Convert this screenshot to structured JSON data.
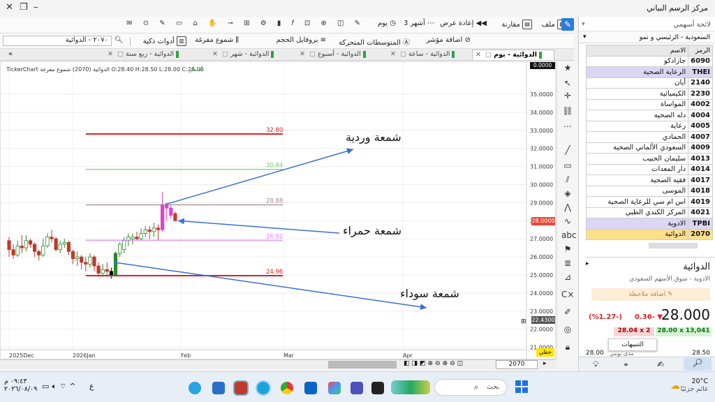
{
  "window": {
    "title": "مركز الرسم البياني"
  },
  "toolbar1": {
    "items": [
      "ملف",
      "مقارنة",
      "إعادة عرض",
      "3 أشهر",
      "يوم"
    ]
  },
  "toolbar2": {
    "items": [
      "أدوات ذكية",
      "شموع مفرغة",
      "بروفايل الحجم",
      "المتوسطات المتحركة",
      "اضافة مؤشر"
    ],
    "symbol_field": "٢٠٧٠ - الدوائية"
  },
  "tabs": [
    "الدوائية - يوم",
    "الدوائية - ساعة",
    "الدوائية - أسبوع",
    "الدوائية - شهر",
    "الدوائية - ربع سنة"
  ],
  "chart": {
    "header": "TickerChart  الدوائية (2070)  شموع مفرغة  O:28.40  H:28.50  L:28.00  C:28.00",
    "small_label": "أسعار",
    "y_ticks": [
      "35.0000",
      "34.0000",
      "33.0000",
      "32.0000",
      "31.0000",
      "30.0000",
      "29.0000",
      "28.0000",
      "27.0000",
      "26.0000",
      "25.0000",
      "24.0000",
      "23.0000",
      "22.0000",
      "21.0000"
    ],
    "x_ticks": [
      "2025Dec",
      "2026Jan",
      "Feb",
      "Mar",
      "Apr"
    ],
    "price_badge": "28.0000",
    "price_badge2": "22.4300",
    "top_badge": "0.0000",
    "bottom_label": "خطي",
    "symbol_code": "2070",
    "levels": [
      {
        "label": "32.80",
        "color": "#d22"
      },
      {
        "label": "30.84",
        "color": "#7c7"
      },
      {
        "label": "28.88",
        "color": "#a88"
      },
      {
        "label": "26.92",
        "color": "#d8f"
      },
      {
        "label": "24.96",
        "color": "#d22"
      }
    ],
    "annotations": [
      "شمعة وردية",
      "شمعة حمراء",
      "شمعة سوداء"
    ]
  },
  "panel": {
    "title": "لائحة أسهمي",
    "market": "السعودية - الرئيسي و نمو",
    "columns": [
      "الرمز",
      "الاسم"
    ],
    "rows": [
      {
        "sym": "6090",
        "name": "جازادكو",
        "type": "row"
      },
      {
        "sym": "THEI",
        "name": "الرعاية الصحية",
        "type": "sec"
      },
      {
        "sym": "2140",
        "name": "أيان",
        "type": "row"
      },
      {
        "sym": "2230",
        "name": "الكيميائية",
        "type": "row"
      },
      {
        "sym": "4002",
        "name": "المواساة",
        "type": "row"
      },
      {
        "sym": "4004",
        "name": "دله الصحية",
        "type": "row"
      },
      {
        "sym": "4005",
        "name": "رعاية",
        "type": "row"
      },
      {
        "sym": "4007",
        "name": "الحمادي",
        "type": "row"
      },
      {
        "sym": "4009",
        "name": "السعودي الألماني الصحية",
        "type": "row"
      },
      {
        "sym": "4013",
        "name": "سليمان الحبيب",
        "type": "row"
      },
      {
        "sym": "4014",
        "name": "دار المعدات",
        "type": "row"
      },
      {
        "sym": "4017",
        "name": "فقيه الصحية",
        "type": "row"
      },
      {
        "sym": "4018",
        "name": "الموسى",
        "type": "row"
      },
      {
        "sym": "4019",
        "name": "اس ام سي للرعاية الصحية",
        "type": "row"
      },
      {
        "sym": "4021",
        "name": "المركز الكندي الطبي",
        "type": "row"
      },
      {
        "sym": "TPBI",
        "name": "الادوية",
        "type": "sec"
      },
      {
        "sym": "2070",
        "name": "الدوائية",
        "type": "sel"
      }
    ],
    "info": {
      "name": "الدوائية",
      "sub": "الادوية - سوق الأسهم السعودي",
      "note_btn": "اضافة ملاحظة",
      "price": "28.000",
      "change": "0.36-",
      "pct": "(%1.27-)",
      "bid": "28.04 x 2",
      "ask": "28.00 x 13,041",
      "alerts": "التنبيهات",
      "low": "28.00",
      "high": "28.50",
      "range_label": "مدى يومي"
    }
  },
  "taskbar": {
    "weather_temp": "20°C",
    "weather_desc": "غائم جزئيًا",
    "search": "بحث",
    "time": "٠٩:٤٣ م",
    "date": "٢٠٢٦/٠٨/٠٩",
    "lang": "ع"
  }
}
